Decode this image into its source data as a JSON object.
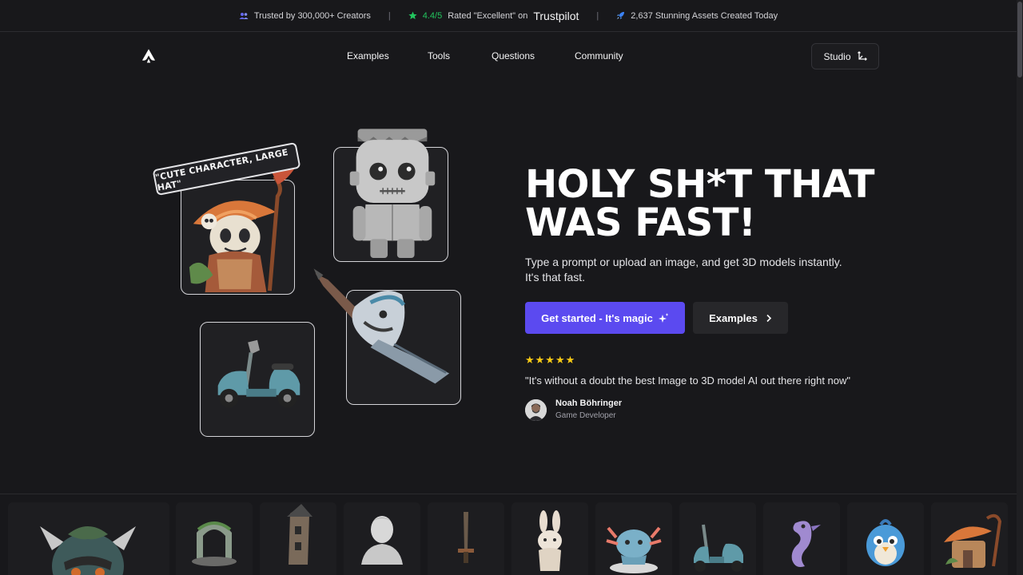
{
  "announcement": {
    "trusted": "Trusted by 300,000+ Creators",
    "rating_score": "4.4/5",
    "rating_text": "Rated \"Excellent\" on",
    "rating_brand": "Trustpilot",
    "assets": "2,637 Stunning Assets Created Today",
    "separator": "|"
  },
  "nav": {
    "items": [
      {
        "label": "Examples"
      },
      {
        "label": "Tools"
      },
      {
        "label": "Questions"
      },
      {
        "label": "Community"
      }
    ],
    "studio_label": "Studio"
  },
  "hero": {
    "prompt_tag": "\"CUTE CHARACTER, LARGE HAT\"",
    "headline_line1": "HOLY SH*T THAT",
    "headline_line2": "WAS FAST!",
    "subhead_line1": "Type a prompt or upload an image, and get 3D models instantly.",
    "subhead_line2": "It's that fast.",
    "primary_cta": "Get started - It's magic",
    "secondary_cta": "Examples",
    "rating_stars": 5,
    "stars_glyphs": "★★★★★",
    "testimonial": "\"It's without a doubt the best Image to 3D model AI out there right now\"",
    "author_name": "Noah Böhringer",
    "author_role": "Game Developer"
  },
  "colors": {
    "background": "#18181b",
    "accent": "#5b4af0",
    "star": "#facc15",
    "trust_green": "#22c55e"
  },
  "gallery": {
    "icons": [
      "demon-head-icon",
      "arch-icon",
      "tower-house-icon",
      "bust-statue-icon",
      "sword-icon",
      "bunny-icon",
      "axolotl-icon",
      "scooter-icon",
      "seahorse-icon",
      "blue-bird-icon",
      "mushroom-house-icon"
    ]
  }
}
